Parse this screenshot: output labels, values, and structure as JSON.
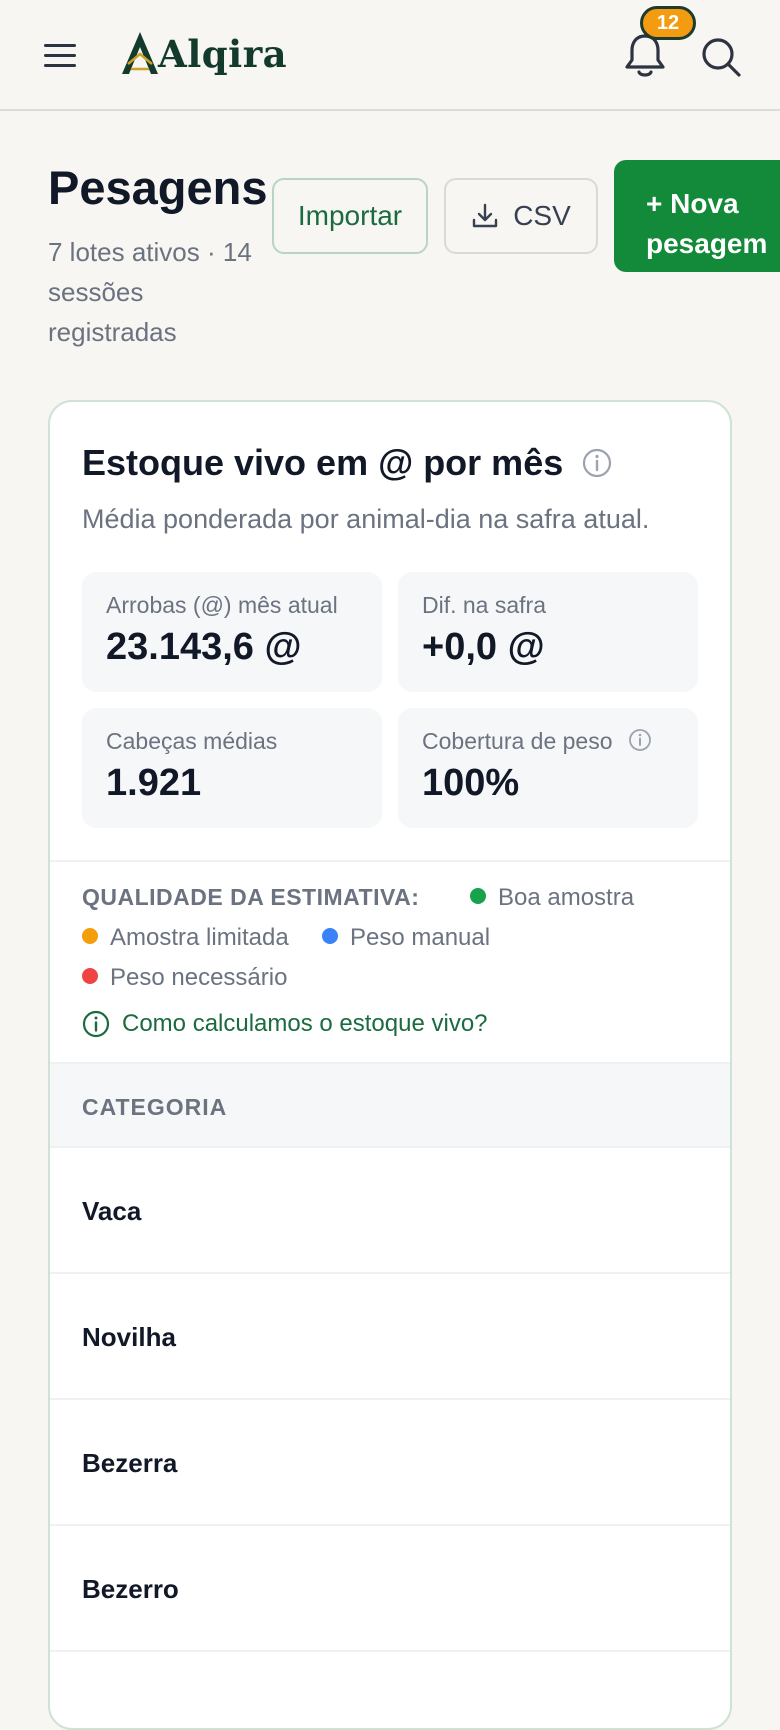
{
  "header": {
    "brand": "Alqira",
    "notifications_count": "12",
    "icons": {
      "menu": "hamburger-menu-icon",
      "bell": "bell-icon",
      "search": "search-icon"
    }
  },
  "page": {
    "title": "Pesagens",
    "subtitle": "7 lotes ativos · 14 sessões registradas",
    "actions": {
      "import_label": "Importar",
      "csv_label": "CSV",
      "new_label": "+ Nova pesagem"
    }
  },
  "card": {
    "title": "Estoque vivo em @ por mês",
    "description": "Média ponderada por animal-dia na safra atual.",
    "stats": [
      {
        "label": "Arrobas (@) mês atual",
        "value": "23.143,6 @"
      },
      {
        "label": "Dif. na safra",
        "value": "+0,0 @"
      },
      {
        "label": "Cabeças médias",
        "value": "1.921"
      },
      {
        "label": "Cobertura de peso",
        "value": "100%"
      }
    ],
    "quality": {
      "heading": "QUALIDADE DA ESTIMATIVA:",
      "legend": [
        {
          "label": "Boa amostra",
          "color": "#16a34a"
        },
        {
          "label": "Amostra limitada",
          "color": "#f59e0b"
        },
        {
          "label": "Peso manual",
          "color": "#3b82f6"
        },
        {
          "label": "Peso necessário",
          "color": "#ef4444"
        }
      ],
      "help_link": "Como calculamos o estoque vivo?"
    },
    "table": {
      "column_header": "CATEGORIA",
      "rows": [
        "Vaca",
        "Novilha",
        "Bezerra",
        "Bezerro"
      ]
    }
  },
  "colors": {
    "brand_green": "#13893a",
    "badge_orange": "#f39c12",
    "link_green": "#1b6b3f"
  }
}
